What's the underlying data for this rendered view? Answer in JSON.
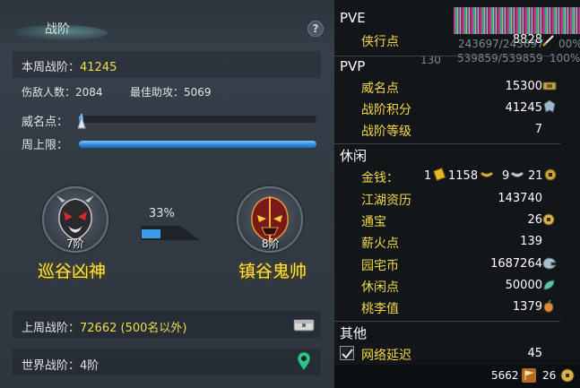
{
  "left": {
    "title": "战阶",
    "help_label": "?",
    "weekly_label": "本周战阶：",
    "weekly_value": "41245",
    "damage_label": "伤敌人数：",
    "damage_value": "2084",
    "assist_label": "最佳助攻：",
    "assist_value": "5069",
    "prestige_label": "威名点：",
    "prestige_fill_fraction": 0.02,
    "week_cap_label": "周上限：",
    "week_cap_fill_fraction": 1.0,
    "current_rank": {
      "name": "巡谷凶神",
      "tier": "7阶"
    },
    "next_rank": {
      "name": "镇谷鬼帅",
      "tier": "8阶"
    },
    "progress_percent_label": "33%",
    "progress_fraction": 0.33,
    "last_week_label": "上周战阶：",
    "last_week_value": "72662 (500名以外)",
    "world_label": "世界战阶：",
    "world_value": "4阶"
  },
  "right": {
    "pve": {
      "header": "PVE",
      "rows": [
        {
          "label": "侠行点",
          "value": "8828",
          "icon": "sword-icon"
        }
      ]
    },
    "ghost_overlay": [
      "243697/243697",
      "130",
      "539859/539859",
      "100%",
      "00%"
    ],
    "pvp": {
      "header": "PVP",
      "rows": [
        {
          "label": "威名点",
          "value": "15300",
          "icon": "prestige-icon"
        },
        {
          "label": "战阶积分",
          "value": "41245",
          "icon": "rank-crest-icon"
        },
        {
          "label": "战阶等级",
          "value": "7",
          "icon": ""
        }
      ]
    },
    "leisure": {
      "header": "休闲",
      "money_label": "金钱：",
      "money_gold": "1",
      "money_silver": "1158",
      "money_copper": "9",
      "money_extra": "21",
      "rows": [
        {
          "label": "江湖资历",
          "value": "143740",
          "icon": ""
        },
        {
          "label": "通宝",
          "value": "26",
          "icon": "coin-icon"
        },
        {
          "label": "薪火点",
          "value": "139",
          "icon": ""
        },
        {
          "label": "园宅币",
          "value": "1687264",
          "icon": "house-coin-icon"
        },
        {
          "label": "休闲点",
          "value": "50000",
          "icon": "leaf-icon"
        },
        {
          "label": "桃李值",
          "value": "1379",
          "icon": "peach-icon"
        }
      ]
    },
    "other": {
      "header": "其他",
      "network_label": "网络延迟",
      "network_value": "45",
      "network_checked": true
    },
    "footer": {
      "points": "5662",
      "coins": "26"
    }
  },
  "colors": {
    "accent_yellow": "#f1dc4a",
    "bar_blue": "#2f8ee0",
    "panel_dark": "#121619"
  }
}
